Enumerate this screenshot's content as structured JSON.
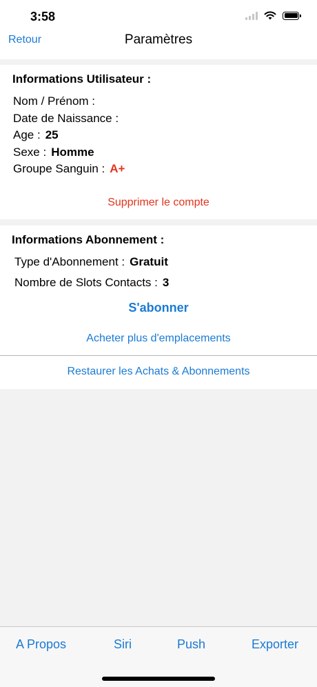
{
  "status_bar": {
    "time": "3:58",
    "icons": [
      "cellular-signal-icon",
      "wifi-icon",
      "battery-icon"
    ]
  },
  "nav": {
    "back_label": "Retour",
    "title": "Paramètres"
  },
  "user_info": {
    "title": "Informations Utilisateur :",
    "name_label": "Nom / Prénom :",
    "name_value": "",
    "birthdate_label": "Date de Naissance :",
    "birthdate_value": "",
    "age_label": "Age :",
    "age_value": "25",
    "sex_label": "Sexe :",
    "sex_value": "Homme",
    "blood_label": "Groupe Sanguin :",
    "blood_value": "A+",
    "delete_label": "Supprimer le compte"
  },
  "subscription": {
    "title": "Informations Abonnement :",
    "type_label": "Type d'Abonnement :",
    "type_value": "Gratuit",
    "slots_label": "Nombre de Slots Contacts :",
    "slots_value": "3",
    "subscribe_label": "S'abonner",
    "buy_slots_label": "Acheter plus d'emplacements"
  },
  "restore": {
    "label": "Restaurer les Achats & Abonnements"
  },
  "tab_bar": {
    "items": [
      {
        "label": "A Propos"
      },
      {
        "label": "Siri"
      },
      {
        "label": "Push"
      },
      {
        "label": "Exporter"
      }
    ]
  },
  "colors": {
    "accent": "#1a7ad4",
    "destructive": "#e2341d",
    "background": "#f2f2f2"
  }
}
